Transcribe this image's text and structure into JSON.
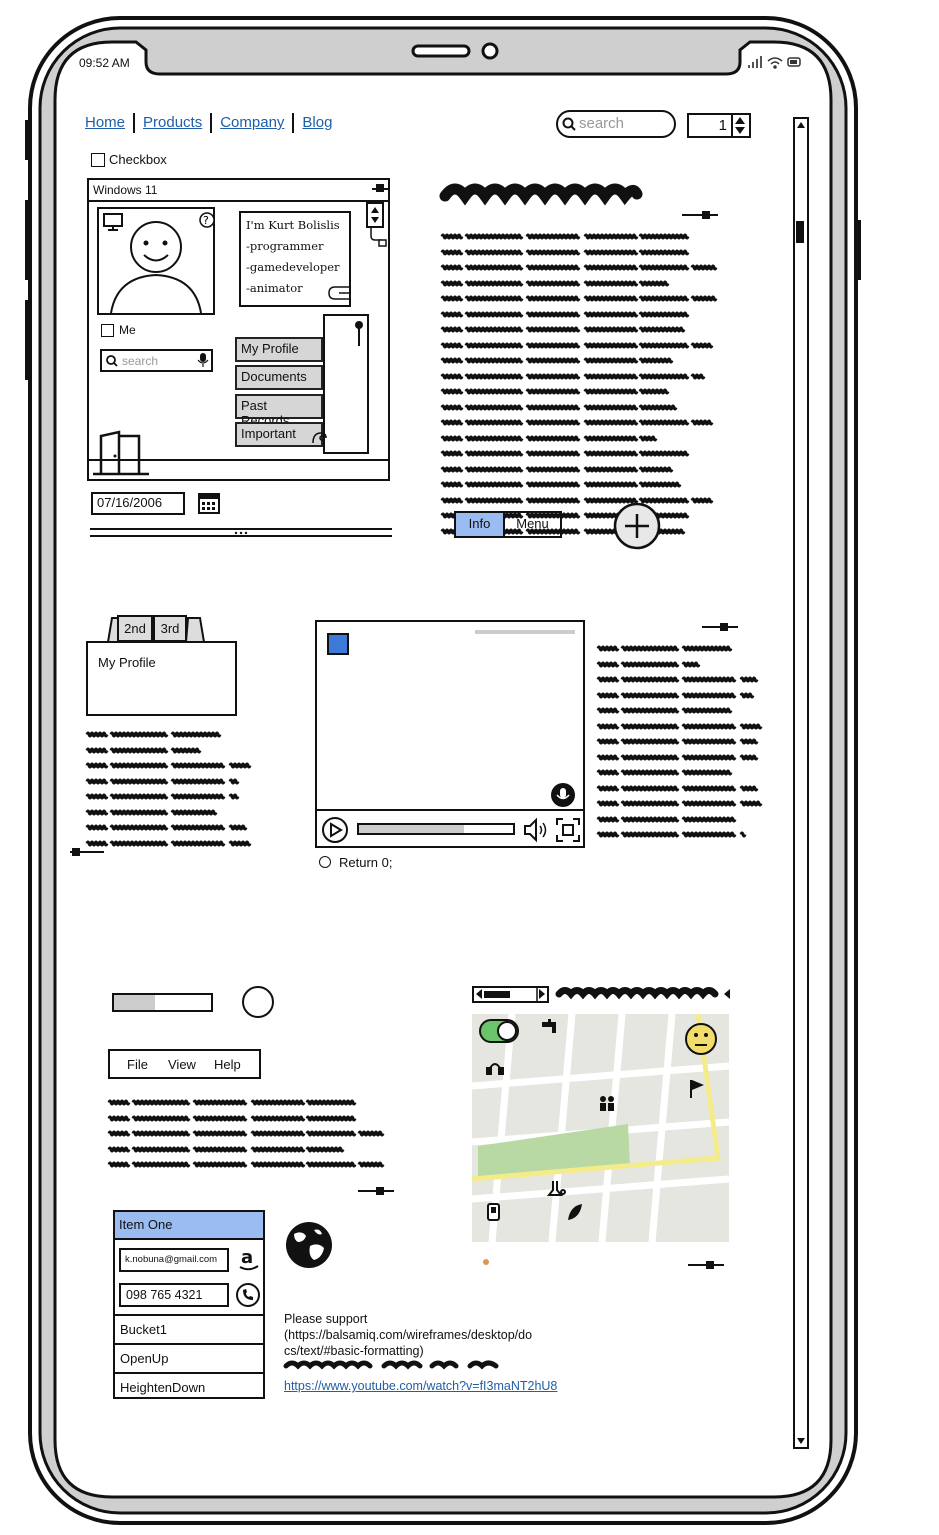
{
  "status": {
    "time": "09:52 AM"
  },
  "nav": {
    "links": [
      "Home",
      "Products",
      "Company",
      "Blog"
    ]
  },
  "search": {
    "placeholder": "search"
  },
  "stepper": {
    "value": "1"
  },
  "checkbox": {
    "label": "Checkbox"
  },
  "window": {
    "title": "Windows 11",
    "bio": [
      "I'm Kurt Bolislis",
      "-programmer",
      "-gamedeveloper",
      "-animator"
    ],
    "me_label": "Me",
    "search_placeholder": "search",
    "menu": [
      "My Profile",
      "Documents",
      "Past Records",
      "Important"
    ]
  },
  "date": {
    "value": "07/16/2006"
  },
  "toggle_buttons": {
    "info": "Info",
    "menu": "Menu"
  },
  "tabs": {
    "labels": [
      "2nd",
      "3rd"
    ],
    "content": "My Profile"
  },
  "video": {
    "radio_label": "Return 0;"
  },
  "menubar": {
    "items": [
      "File",
      "View",
      "Help"
    ]
  },
  "contact_list": {
    "header": "Item One",
    "email": "k.nobuna@gmail.com",
    "phone": "098 765 4321",
    "items": [
      "Bucket1",
      "OpenUp",
      "HeightenDown"
    ]
  },
  "support": {
    "text_line1": "Please support",
    "text_line2": "(https://balsamiq.com/wireframes/desktop/do",
    "text_line3": "cs/text/#basic-formatting)",
    "link": "https://www.youtube.com/watch?v=fI3maNT2hU8"
  },
  "icons": {
    "signal": "signal-icon",
    "wifi": "wifi-icon",
    "battery": "battery-icon",
    "search": "search-icon",
    "help": "help-icon",
    "monitor": "monitor-icon",
    "mic": "microphone-icon",
    "calendar": "calendar-icon",
    "plus": "plus-icon",
    "globe": "globe-icon",
    "phone": "phone-icon",
    "amazon": "amazon-icon",
    "play": "play-icon",
    "volume": "volume-icon",
    "fullscreen": "fullscreen-icon",
    "smiley": "smiley-icon",
    "flag": "flag-icon"
  },
  "colors": {
    "highlight": "#9bbcf0",
    "link": "#1f5fa8",
    "toggle_on": "#6ac46a",
    "map_park": "#b9d9a4",
    "map_road": "#f4ec8a"
  }
}
